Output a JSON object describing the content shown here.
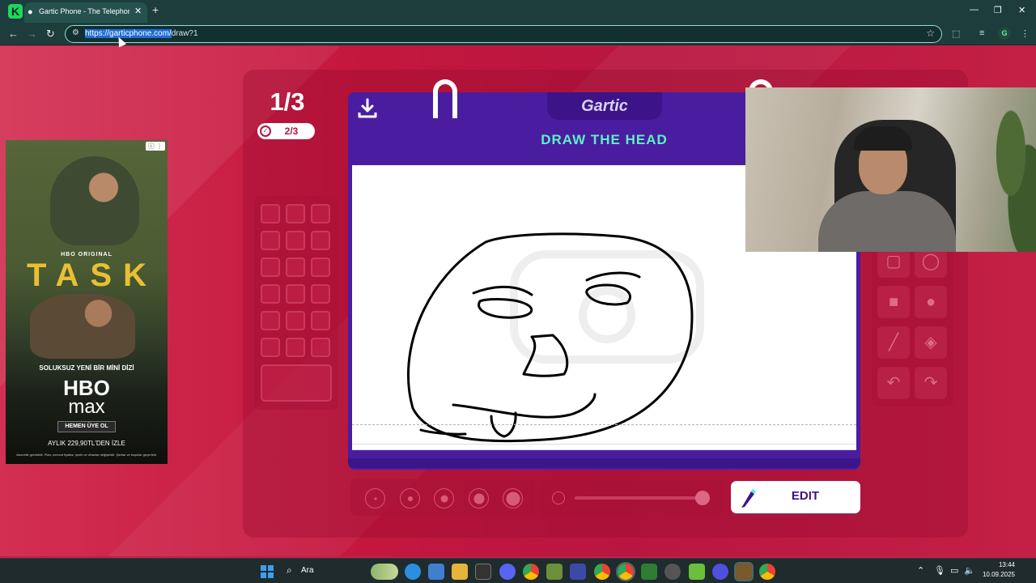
{
  "browser": {
    "tab_title": "Gartic Phone - The Telephone Game",
    "tab_close": "✕",
    "new_tab": "+",
    "url_selected": "https://garticphone.com/",
    "url_rest": "draw?1",
    "profile_initial": "G",
    "window_controls": {
      "minimize": "—",
      "restore": "❐",
      "close": "✕"
    }
  },
  "ad": {
    "badge": "ⓘ ⋮",
    "hbo_original": "HBO ORIGINAL",
    "title": "TASK",
    "tagline": "SOLUKSUZ YENİ BİR MİNİ DİZİ",
    "logo_line1": "HBO",
    "logo_line2": "max",
    "cta": "HEMEN ÜYE OL",
    "price": "AYLIK 229,90TL'DEN İZLE",
    "fine_print": "Abonelik gereklidir. Plan, mevcut fiyatlar, içerik ve cihazlar değişebilir. Şartlar ve koşullar geçerlidir."
  },
  "game": {
    "round": "1/3",
    "done_count": "2/3",
    "logo": "Gartic",
    "prompt": "DRAW THE HEAD",
    "edit_label": "EDIT",
    "brush_sizes": 5,
    "opacity": 1.0
  },
  "taskbar": {
    "search_placeholder": "Ara",
    "time": "13:44",
    "date": "10.09.2025"
  },
  "colors": {
    "page_background": "#c41e48",
    "board": "#4a1da0",
    "prompt_text": "#5ef0c7",
    "browser_chrome": "#1c3d3c"
  }
}
